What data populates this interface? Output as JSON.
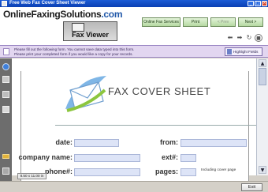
{
  "window": {
    "title": "Free Web Fax Cover Sheet Viewer"
  },
  "header": {
    "brand_name": "OnlineFaxingSolutions",
    "brand_dot": ".",
    "brand_tld": "com",
    "viewer_label": "Fax Viewer"
  },
  "toolbar": {
    "online_fax_services": "Online Fax Services",
    "print": "Print",
    "prev": "< Prev",
    "next": "Next >"
  },
  "notice": {
    "line1": "Please fill out the following form. You cannot save data typed into this form.",
    "line2": "Please print your completed form if you would like a copy for your records.",
    "highlight_fields": "Highlight Fields"
  },
  "document": {
    "title": "FAX COVER SHEET",
    "fields": {
      "date": "date:",
      "from": "from:",
      "company_name": "company name:",
      "ext": "ext#:",
      "phone": "phone#:",
      "pages": "pages:",
      "including_cover_page": "Including cover page"
    }
  },
  "statusbar": {
    "page_size": "8.50 x 11.00 in",
    "exit": "Exit"
  },
  "colors": {
    "title_bar": "#0a3fb3",
    "notice_bg": "#e2d6f0",
    "field_bg": "#dde4f7",
    "nav_button": "#b6d9a2",
    "sidebar": "#6d6d6d"
  },
  "icons": {
    "nav": [
      "arrow-left-icon",
      "arrow-right-icon",
      "refresh-icon",
      "stop-icon"
    ],
    "sidebar": [
      "info-icon",
      "layers-icon",
      "pages-icon",
      "attachment-icon",
      "signature-icon",
      "tools-icon"
    ]
  }
}
